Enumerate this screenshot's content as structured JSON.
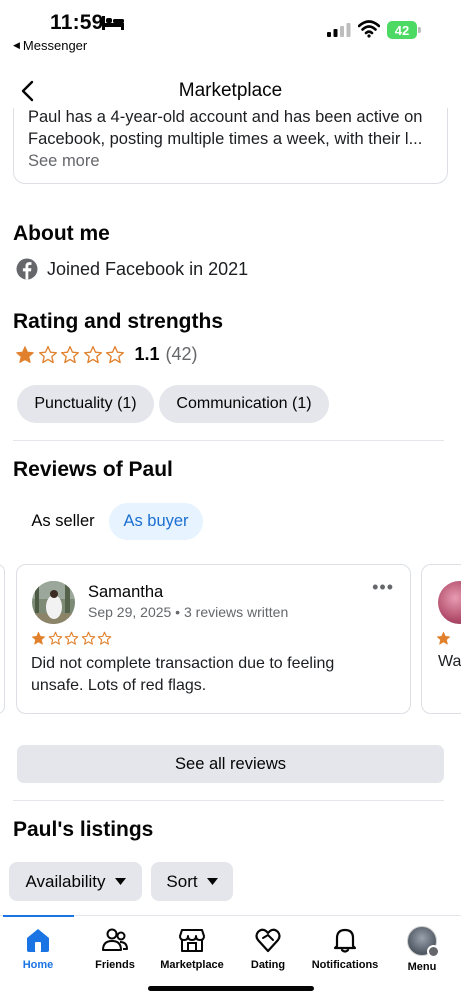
{
  "status_bar": {
    "time": "11:59",
    "back_app": "Messenger",
    "battery": "42"
  },
  "header": {
    "title": "Marketplace"
  },
  "bio": {
    "text": "Paul has a 4-year-old account and has been active on Facebook, posting multiple times a week, with their l...",
    "see_more": "See more"
  },
  "about": {
    "title": "About me",
    "joined": "Joined Facebook in 2021"
  },
  "rating": {
    "title": "Rating and strengths",
    "value": "1.1",
    "count": "(42)",
    "stars_filled": 1,
    "stars_total": 5,
    "strengths": [
      "Punctuality (1)",
      "Communication (1)"
    ]
  },
  "reviews": {
    "title": "Reviews of Paul",
    "tabs": [
      "As seller",
      "As buyer"
    ],
    "active_tab": "As buyer",
    "items": [
      {
        "name": "Samantha",
        "meta": "Sep 29, 2025 • 3 reviews written",
        "stars": 1,
        "text": "Did not complete transaction due to feeling unsafe. Lots of red flags."
      }
    ],
    "next_preview_text": "Wa",
    "see_all": "See all reviews"
  },
  "listings": {
    "title": "Paul's listings",
    "filters": [
      "Availability",
      "Sort"
    ]
  },
  "bottom_nav": {
    "items": [
      {
        "label": "Home",
        "icon": "home-icon"
      },
      {
        "label": "Friends",
        "icon": "friends-icon"
      },
      {
        "label": "Marketplace",
        "icon": "marketplace-icon"
      },
      {
        "label": "Dating",
        "icon": "dating-icon"
      },
      {
        "label": "Notifications",
        "icon": "bell-icon"
      },
      {
        "label": "Menu",
        "icon": "profile-avatar"
      }
    ],
    "active": "Home"
  },
  "colors": {
    "accent": "#1b74e4",
    "star": "#e2812d",
    "chip_bg": "#e4e6eb",
    "tab_active_bg": "#e7f3ff"
  }
}
